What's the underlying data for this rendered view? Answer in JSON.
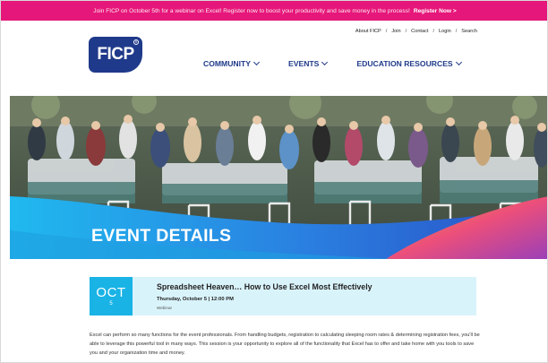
{
  "promo_bar": {
    "message": "Join FICP on October 5th for a webinar on Excel! Register now to boost your productivity and save money in the process!",
    "link_label": "Register Now >"
  },
  "logo": {
    "text": "FICP",
    "reg_mark": "R"
  },
  "utility_nav": [
    {
      "label": "About FICP"
    },
    {
      "label": "Join"
    },
    {
      "label": "Contact"
    },
    {
      "label": "Login"
    },
    {
      "label": "Search"
    }
  ],
  "utility_separator": "/",
  "main_nav": [
    {
      "label": "COMMUNITY"
    },
    {
      "label": "EVENTS"
    },
    {
      "label": "EDUCATION RESOURCES"
    }
  ],
  "hero": {
    "title": "EVENT DETAILS"
  },
  "event": {
    "month": "OCT",
    "day": "5",
    "title": "Spreadsheet Heaven… How to Use Excel Most Effectively",
    "datetime": "Thursday, October 5 | 12:00 PM",
    "type": "Webinar"
  },
  "description": "Excel can perform so many functions for the event professionals. From handling budgets, registration to calculating sleeping room rates & determining registration fees, you'll be able to leverage this powerful tool in many ways. This session is your opportunity to explore all of the functionality that Excel has to offer and take home with you tools to save you and your organization time and money.",
  "colors": {
    "promo_pink": "#e6177a",
    "brand_navy": "#1f3a8a",
    "accent_cyan": "#19b3e6",
    "card_bg": "#d9f3fb"
  }
}
